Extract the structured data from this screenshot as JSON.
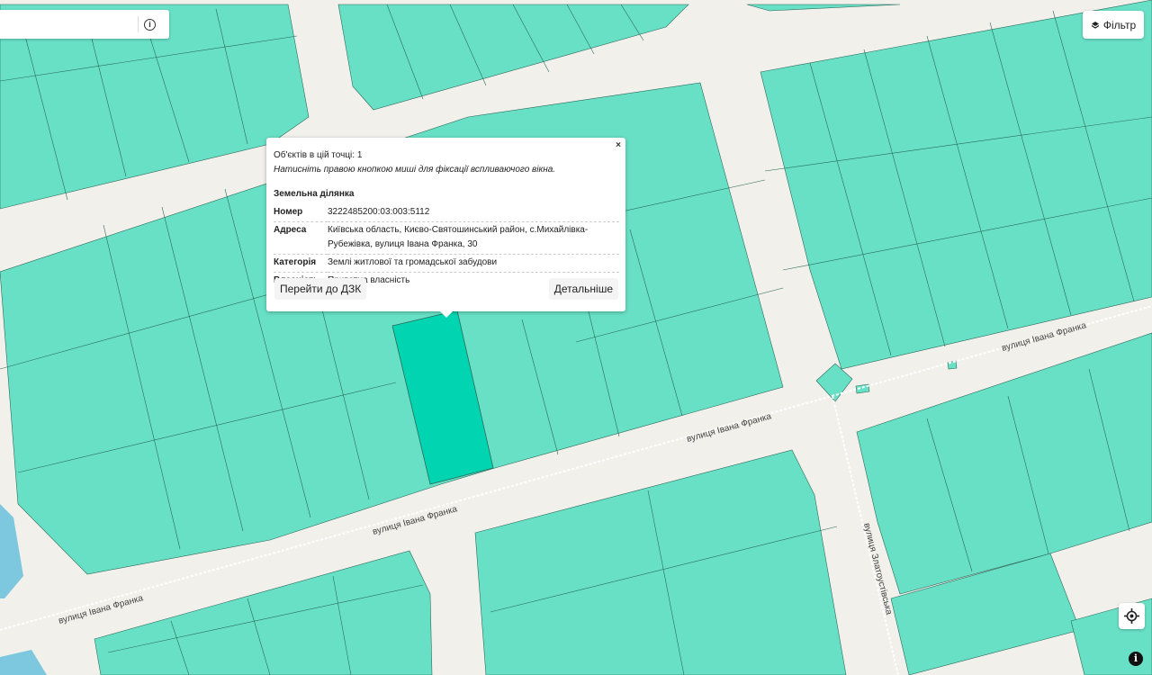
{
  "search": {
    "placeholder": "",
    "value": ""
  },
  "info_icon": "i",
  "filter": {
    "label": "Фільтр",
    "icon": "layers-icon"
  },
  "popup": {
    "close_symbol": "×",
    "count_text": "Об'єктів в цій точці: 1",
    "hint": "Натисніть правою кнопкою миші для фіксації вспливаючого вікна.",
    "title": "Земельна ділянка",
    "rows": [
      {
        "key": "Номер",
        "value": "3222485200:03:003:5112"
      },
      {
        "key": "Адреса",
        "value": "Київська область, Києво-Святошинський район, с.Михайлівка-Рубежівка, вулиця Івана Франка, 30"
      },
      {
        "key": "Категорія",
        "value": "Землі житлової та громадської забудови"
      },
      {
        "key": "Власність",
        "value": "Приватна власність"
      }
    ],
    "goto_button": "Перейти до ДЗК",
    "details_button": "Детальніше"
  },
  "map": {
    "parcel_color": "#68e0c6",
    "selected_color": "#00d4b0",
    "road_color": "#f2f0eb",
    "water_color": "#7ec8df",
    "street_labels": [
      "вулиця Івана Франка",
      "вулиця Івана Франка",
      "вулиця Івана Франка",
      "вулиця Івана Франка",
      "вулиця Златоустівська"
    ]
  },
  "controls": {
    "locate_icon": "crosshair-icon",
    "attribution_icon": "i"
  }
}
